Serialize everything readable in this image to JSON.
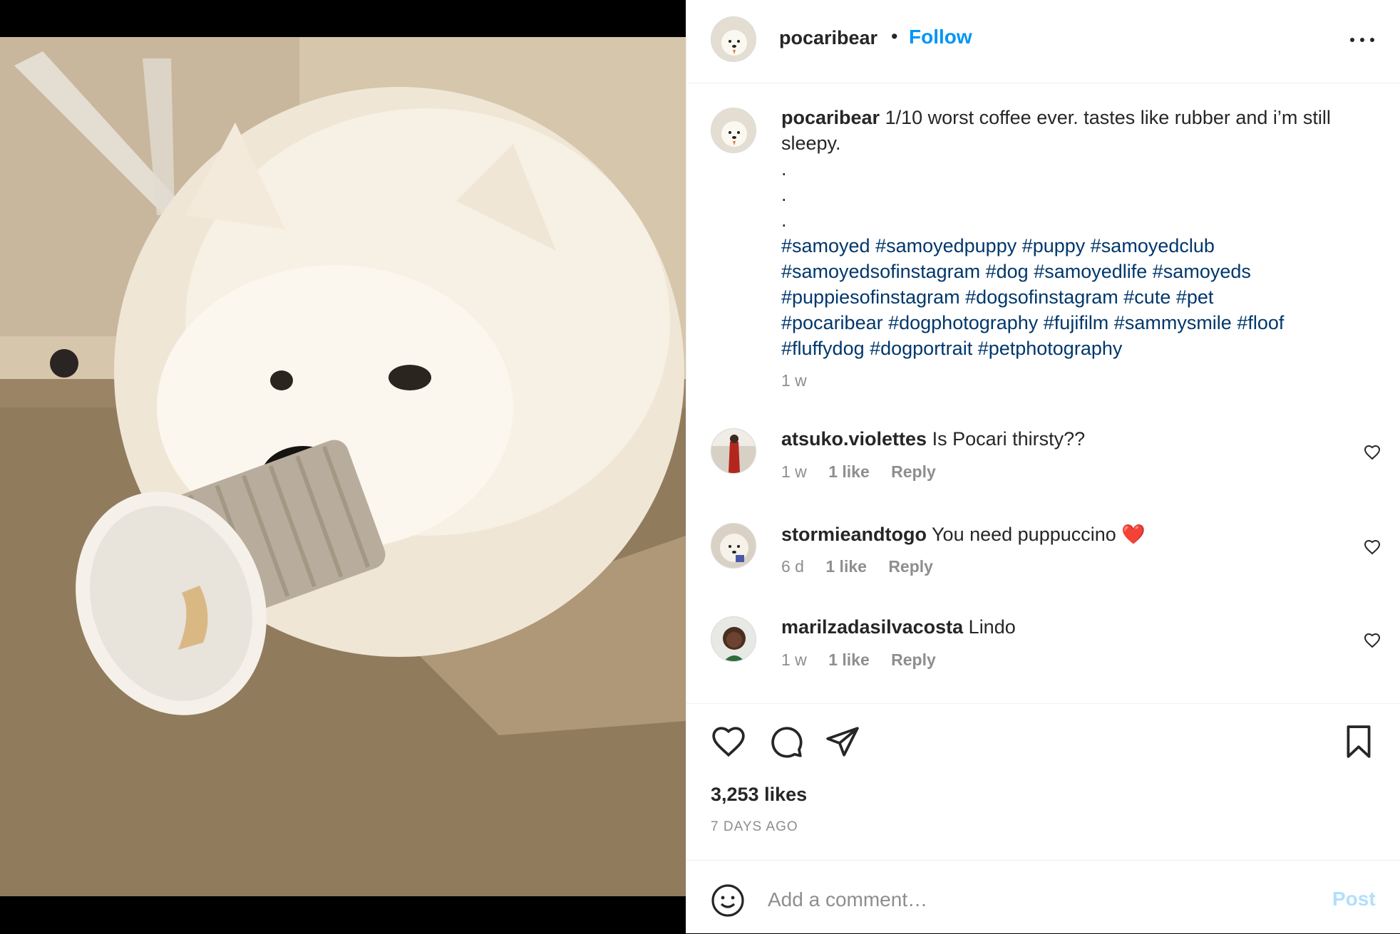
{
  "post": {
    "username": "pocaribear",
    "separator": "•",
    "follow_label": "Follow",
    "more_icon": "more-horizontal-icon"
  },
  "caption": {
    "username": "pocaribear",
    "text": "1/10 worst coffee ever. tastes like rubber and i’m still sleepy.",
    "dots": [
      ".",
      ".",
      "."
    ],
    "hashtags": [
      "#samoyed #samoyedpuppy #puppy #samoyedclub",
      "#samoyedsofinstagram #dog #samoyedlife #samoyeds",
      "#puppiesofinstagram #dogsofinstagram #cute #pet",
      "#pocaribear #dogphotography #fujifilm #sammysmile #floof",
      "#fluffydog #dogportrait #petphotography"
    ],
    "time": "1 w"
  },
  "comments": [
    {
      "username": "atsuko.violettes",
      "text": "Is Pocari thirsty??",
      "time": "1 w",
      "likes": "1 like",
      "reply": "Reply"
    },
    {
      "username": "stormieandtogo",
      "text": "You need puppuccino ❤️",
      "time": "6 d",
      "likes": "1 like",
      "reply": "Reply"
    },
    {
      "username": "marilzadasilvacosta",
      "text": "Lindo",
      "time": "1 w",
      "likes": "1 like",
      "reply": "Reply"
    }
  ],
  "actions": {
    "like_icon": "heart-icon",
    "comment_icon": "comment-bubble-icon",
    "share_icon": "paper-plane-icon",
    "save_icon": "bookmark-icon",
    "likes_count": "3,253 likes",
    "posted_ago": "7 DAYS AGO"
  },
  "add_comment": {
    "placeholder": "Add a comment…",
    "post_label": "Post",
    "emoji_icon": "smiley-icon"
  },
  "colors": {
    "link_blue": "#0095f6",
    "hashtag_blue": "#00376b",
    "muted_gray": "#8e8e8e",
    "post_disabled": "#b2dffc"
  }
}
